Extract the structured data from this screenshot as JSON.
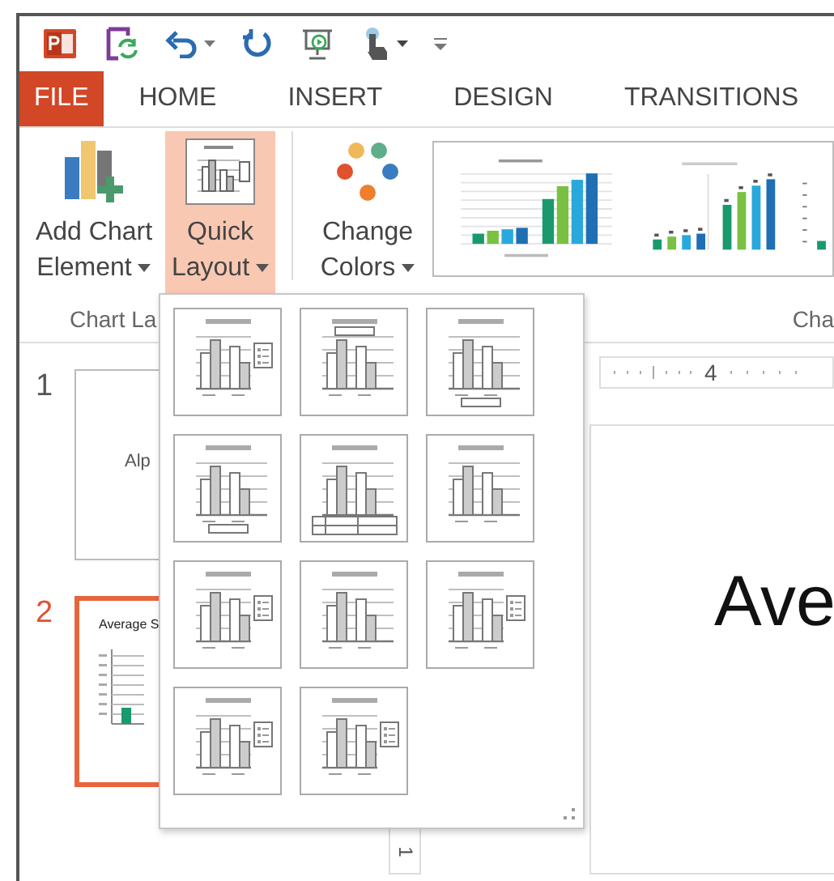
{
  "tabs": [
    {
      "label": "FILE",
      "kind": "file",
      "selected": false
    },
    {
      "label": "HOME",
      "kind": "tab",
      "selected": false
    },
    {
      "label": "INSERT",
      "kind": "tab",
      "selected": false
    },
    {
      "label": "DESIGN",
      "kind": "tab",
      "selected": false
    },
    {
      "label": "TRANSITIONS",
      "kind": "tab",
      "selected": false
    }
  ],
  "ribbon": {
    "buttons": [
      {
        "label": "Add Chart Element",
        "kind": "add-element",
        "pressed": false,
        "dropdown": true
      },
      {
        "label": "Quick Layout",
        "kind": "quick-layout",
        "pressed": true,
        "dropdown": true
      },
      {
        "label": "Change Colors",
        "kind": "change-colors",
        "pressed": false,
        "dropdown": true
      }
    ],
    "group_labels": [
      "Chart La",
      "Cha"
    ]
  },
  "quick_layouts": [
    {
      "kind": "right"
    },
    {
      "kind": "top"
    },
    {
      "kind": "bottom"
    },
    {
      "kind": "bottom"
    },
    {
      "kind": "table"
    },
    {
      "kind": "none"
    },
    {
      "kind": "right"
    },
    {
      "kind": "none"
    },
    {
      "kind": "right"
    },
    {
      "kind": "right"
    },
    {
      "kind": "right"
    }
  ],
  "slides": [
    {
      "number": "1",
      "title": "Alp",
      "kind": "title",
      "selected": false
    },
    {
      "number": "2",
      "title": "Average S",
      "kind": "chart",
      "selected": true
    }
  ],
  "ruler": {
    "label": "4"
  },
  "vertical_ruler": {
    "label": "1"
  },
  "slide": {
    "title": "Ave"
  }
}
